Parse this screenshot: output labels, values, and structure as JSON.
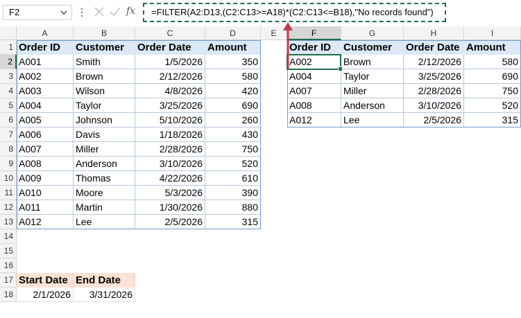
{
  "formula_bar": {
    "name_box": "F2",
    "fx_label": "fx",
    "formula": "=FILTER(A2:D13,(C2:C13>=A18)*(C2:C13<=B18),\"No records found\")"
  },
  "columns": [
    "A",
    "B",
    "C",
    "D",
    "E",
    "F",
    "G",
    "H",
    "I"
  ],
  "rows": [
    "1",
    "2",
    "3",
    "4",
    "5",
    "6",
    "7",
    "8",
    "9",
    "10",
    "11",
    "12",
    "13",
    "14",
    "15",
    "16",
    "17",
    "18"
  ],
  "source_table": {
    "headers": [
      "Order ID",
      "Customer",
      "Order Date",
      "Amount"
    ],
    "rows": [
      [
        "A001",
        "Smith",
        "1/5/2026",
        "350"
      ],
      [
        "A002",
        "Brown",
        "2/12/2026",
        "580"
      ],
      [
        "A003",
        "Wilson",
        "4/8/2026",
        "420"
      ],
      [
        "A004",
        "Taylor",
        "3/25/2026",
        "690"
      ],
      [
        "A005",
        "Johnson",
        "5/10/2026",
        "260"
      ],
      [
        "A006",
        "Davis",
        "1/18/2026",
        "430"
      ],
      [
        "A007",
        "Miller",
        "2/28/2026",
        "750"
      ],
      [
        "A008",
        "Anderson",
        "3/10/2026",
        "520"
      ],
      [
        "A009",
        "Thomas",
        "4/22/2026",
        "610"
      ],
      [
        "A010",
        "Moore",
        "5/3/2026",
        "390"
      ],
      [
        "A011",
        "Martin",
        "1/30/2026",
        "880"
      ],
      [
        "A012",
        "Lee",
        "2/5/2026",
        "315"
      ]
    ]
  },
  "result_table": {
    "headers": [
      "Order ID",
      "Customer",
      "Order Date",
      "Amount"
    ],
    "rows": [
      [
        "A002",
        "Brown",
        "2/12/2026",
        "580"
      ],
      [
        "A004",
        "Taylor",
        "3/25/2026",
        "690"
      ],
      [
        "A007",
        "Miller",
        "2/28/2026",
        "750"
      ],
      [
        "A008",
        "Anderson",
        "3/10/2026",
        "520"
      ],
      [
        "A012",
        "Lee",
        "2/5/2026",
        "315"
      ]
    ]
  },
  "criteria": {
    "headers": [
      "Start Date",
      "End Date"
    ],
    "values": [
      "2/1/2026",
      "3/31/2026"
    ]
  },
  "colors": {
    "selection": "#1e6e4a",
    "table_header": "#dbe9f6",
    "criteria_header": "#fbe2d5",
    "arrow": "#c0394b"
  }
}
